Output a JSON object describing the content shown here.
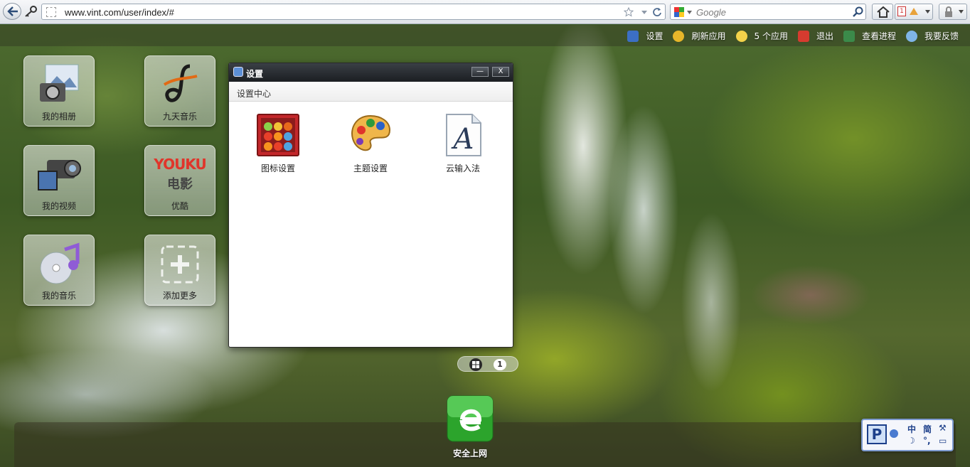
{
  "browser": {
    "url": "www.vint.com/user/index/#",
    "search_placeholder": "Google",
    "tab_count": "1"
  },
  "top_menu": [
    {
      "label": "设置",
      "icon": "gear-icon"
    },
    {
      "label": "刷新应用",
      "icon": "refresh-icon"
    },
    {
      "label": "5 个应用",
      "icon": "smiley-icon"
    },
    {
      "label": "退出",
      "icon": "power-icon"
    },
    {
      "label": "查看进程",
      "icon": "process-icon"
    },
    {
      "label": "我要反馈",
      "icon": "feedback-icon"
    }
  ],
  "tiles": [
    {
      "label": "我的相册",
      "icon": "camera-icon"
    },
    {
      "label": "九天音乐",
      "icon": "music-note-icon"
    },
    {
      "label": "我的视频",
      "icon": "video-camera-icon"
    },
    {
      "label": "优酷",
      "icon": "youku-logo",
      "logo_top": "YOUKU",
      "logo_bottom": "电影"
    },
    {
      "label": "我的音乐",
      "icon": "cd-music-icon"
    },
    {
      "label": "添加更多",
      "icon": "add-icon"
    }
  ],
  "settings_window": {
    "title": "设置",
    "subtitle": "设置中心",
    "minimize": "—",
    "close": "X",
    "options": [
      {
        "label": "图标设置",
        "icon": "icon-settings-icon"
      },
      {
        "label": "主题设置",
        "icon": "palette-icon"
      },
      {
        "label": "云输入法",
        "icon": "font-a-icon"
      }
    ]
  },
  "pager": {
    "current": "1"
  },
  "dock": [
    {
      "label": "安全上网",
      "icon": "browser-e-icon"
    }
  ],
  "ime": {
    "chinese": "中",
    "simplified": "简"
  },
  "colors": {
    "accent": "#2a9a2a",
    "window_title": "#1b1e22"
  }
}
